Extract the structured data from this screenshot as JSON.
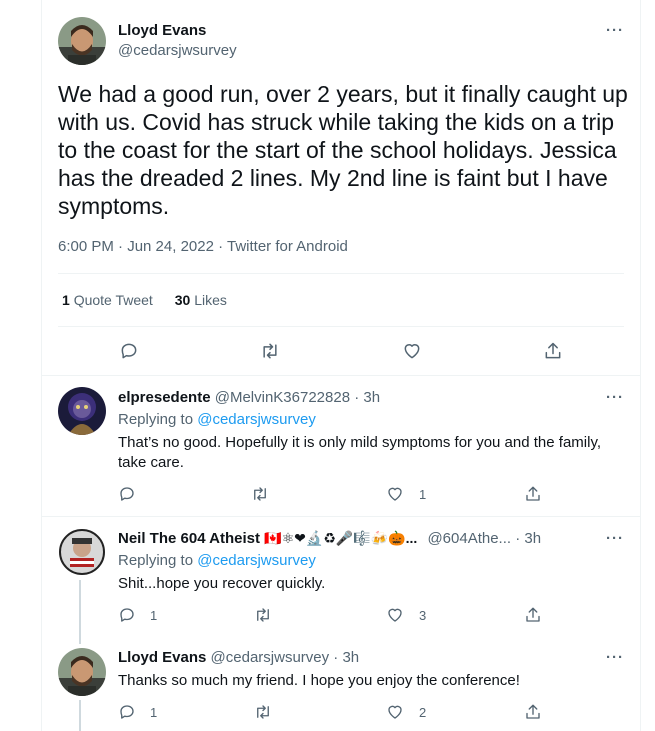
{
  "main_tweet": {
    "author_name": "Lloyd Evans",
    "author_handle": "@cedarsjwsurvey",
    "text": "We had a good run, over 2 years, but it finally caught up with us. Covid has struck while taking the kids on a trip to the coast for the start of the school holidays. Jessica has the dreaded 2 lines. My 2nd line is faint but I have symptoms.",
    "timestamp": "6:00 PM · Jun 24, 2022 · Twitter for Android",
    "quote_count": "1",
    "quote_label": "Quote Tweet",
    "like_count": "30",
    "like_label": "Likes",
    "more": "···"
  },
  "replies": [
    {
      "name": "elpresedente",
      "handle": "@MelvinK36722828",
      "time": "· 3h",
      "replying_prefix": "Replying to",
      "replying_to": "@cedarsjwsurvey",
      "text": "That’s no good. Hopefully it is only mild symptoms for you and the family, take care.",
      "reply_count": "",
      "retweet_count": "",
      "like_count": "1",
      "more": "···"
    },
    {
      "name": "Neil The 604 Atheist",
      "name_emojis": "🇨🇦⚛❤🔬♻🎤🎼🍻🎃...",
      "handle": "@604Athe...",
      "time": "· 3h",
      "replying_prefix": "Replying to",
      "replying_to": "@cedarsjwsurvey",
      "text": "Shit...hope you recover quickly.",
      "reply_count": "1",
      "retweet_count": "",
      "like_count": "3",
      "more": "···"
    },
    {
      "name": "Lloyd Evans",
      "handle": "@cedarsjwsurvey",
      "time": "· 3h",
      "text": "Thanks so much my friend. I hope you enjoy the conference!",
      "reply_count": "1",
      "retweet_count": "",
      "like_count": "2",
      "more": "···"
    }
  ],
  "colors": {
    "accent": "#1d9bf0",
    "secondary_text": "#536471",
    "border": "#eff3f4"
  }
}
